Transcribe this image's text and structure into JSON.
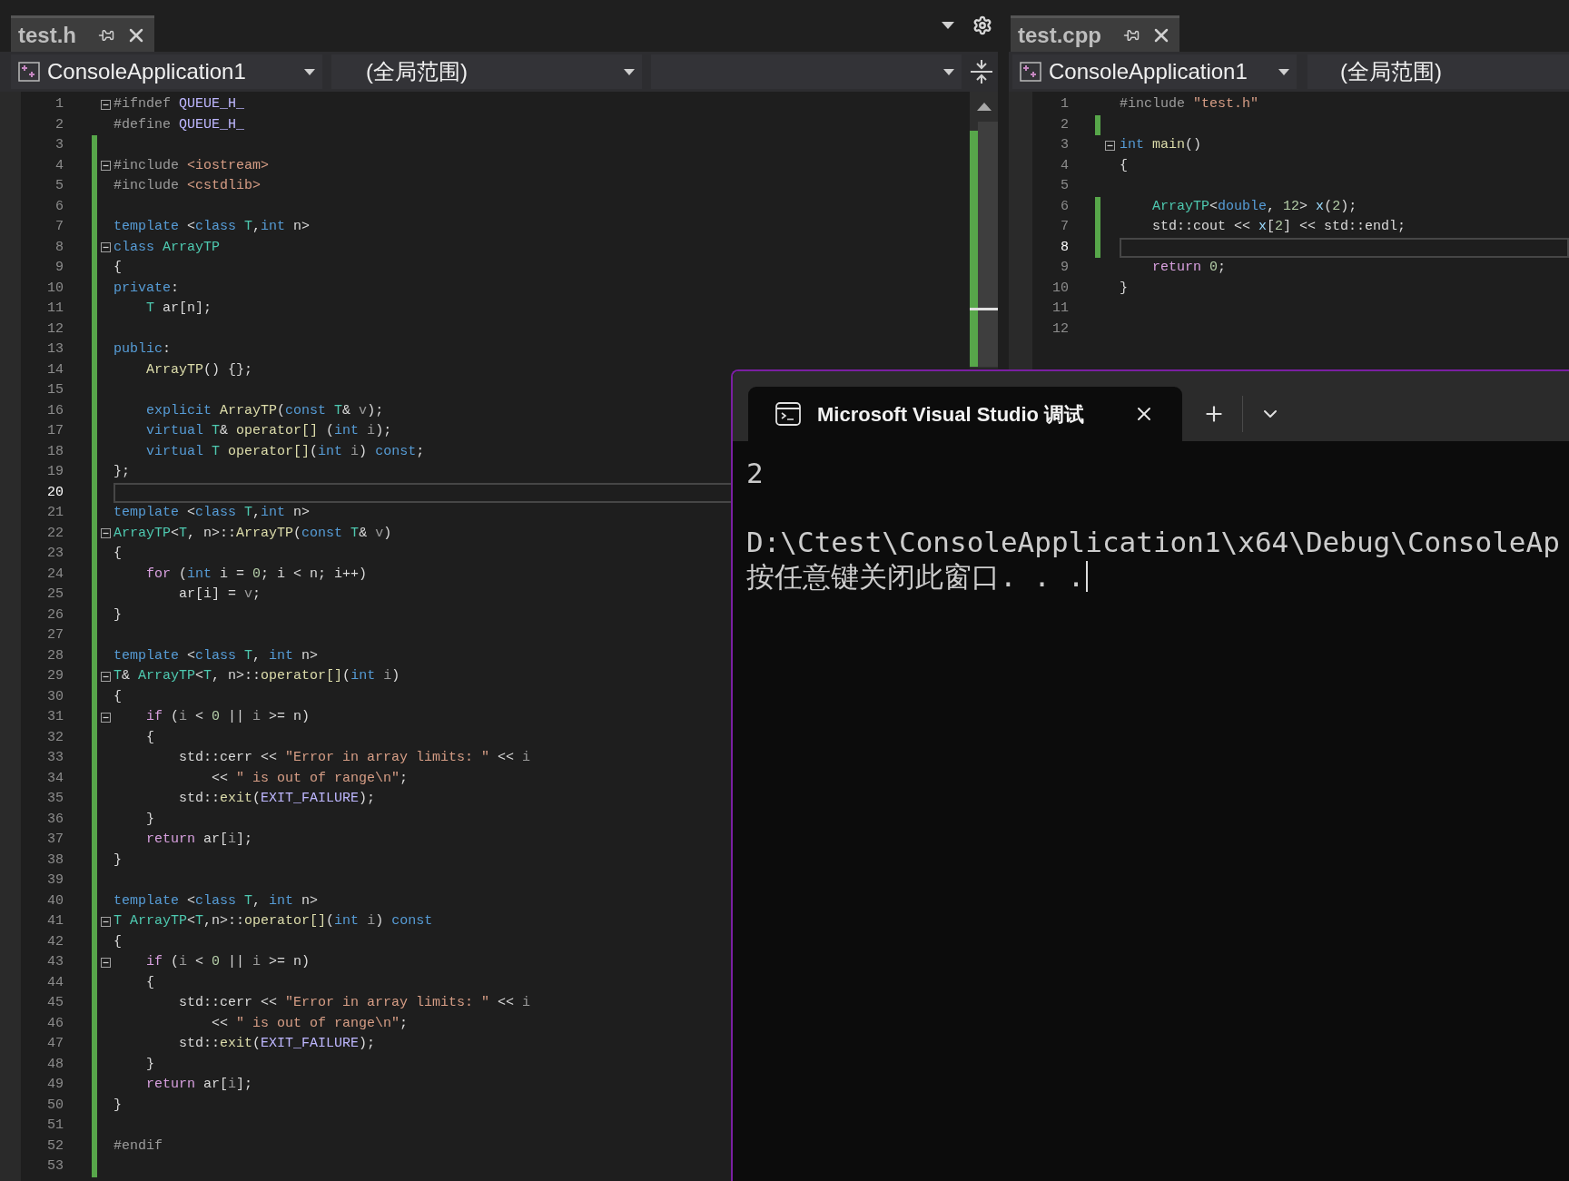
{
  "left_editor": {
    "tab": {
      "title": "test.h"
    },
    "project": "ConsoleApplication1",
    "scope": "(全局范围)",
    "lines": [
      {
        "num": "1",
        "foldable": true,
        "changed": false,
        "current": false,
        "segs": [
          {
            "kind": "pp",
            "t": "#ifndef "
          },
          {
            "kind": "macro",
            "t": "QUEUE_H_"
          }
        ]
      },
      {
        "num": "2",
        "foldable": false,
        "changed": false,
        "current": false,
        "segs": [
          {
            "kind": "pp",
            "t": "#define "
          },
          {
            "kind": "macro",
            "t": "QUEUE_H_"
          }
        ]
      },
      {
        "num": "3",
        "foldable": false,
        "changed": true,
        "current": false
      },
      {
        "num": "4",
        "foldable": true,
        "changed": true,
        "current": false,
        "segs": [
          {
            "kind": "pp",
            "t": "#include "
          },
          {
            "kind": "str",
            "t": "<iostream>"
          }
        ]
      },
      {
        "num": "5",
        "foldable": false,
        "changed": true,
        "current": false,
        "segs": [
          {
            "kind": "pp",
            "t": "#include "
          },
          {
            "kind": "str",
            "t": "<cstdlib>"
          }
        ]
      },
      {
        "num": "6",
        "foldable": false,
        "changed": true,
        "current": false
      },
      {
        "num": "7",
        "foldable": false,
        "changed": true,
        "current": false,
        "segs": [
          {
            "kind": "kw",
            "t": "template "
          },
          {
            "kind": "pl",
            "t": "<"
          },
          {
            "kind": "kw",
            "t": "class "
          },
          {
            "kind": "type",
            "t": "T"
          },
          {
            "kind": "pl",
            "t": ","
          },
          {
            "kind": "kw",
            "t": "int "
          },
          {
            "kind": "pl",
            "t": "n>"
          }
        ]
      },
      {
        "num": "8",
        "foldable": true,
        "changed": true,
        "current": false,
        "segs": [
          {
            "kind": "kw",
            "t": "class "
          },
          {
            "kind": "type",
            "t": "ArrayTP"
          }
        ]
      },
      {
        "num": "9",
        "foldable": false,
        "changed": true,
        "current": false,
        "segs": [
          {
            "kind": "pl",
            "t": "{"
          }
        ]
      },
      {
        "num": "10",
        "foldable": false,
        "changed": true,
        "current": false,
        "segs": [
          {
            "kind": "kw",
            "t": "private"
          },
          {
            "kind": "pl",
            "t": ":"
          }
        ]
      },
      {
        "num": "11",
        "foldable": false,
        "changed": true,
        "current": false,
        "segs": [
          {
            "kind": "type",
            "t": "    T"
          },
          {
            "kind": "pl",
            "t": " ar[n];"
          }
        ]
      },
      {
        "num": "12",
        "foldable": false,
        "changed": true,
        "current": false
      },
      {
        "num": "13",
        "foldable": false,
        "changed": true,
        "current": false,
        "segs": [
          {
            "kind": "kw",
            "t": "public"
          },
          {
            "kind": "pl",
            "t": ":"
          }
        ]
      },
      {
        "num": "14",
        "foldable": false,
        "changed": true,
        "current": false,
        "segs": [
          {
            "kind": "fn",
            "t": "    ArrayTP"
          },
          {
            "kind": "pl",
            "t": "() {};"
          }
        ]
      },
      {
        "num": "15",
        "foldable": false,
        "changed": true,
        "current": false
      },
      {
        "num": "16",
        "foldable": false,
        "changed": true,
        "current": false,
        "segs": [
          {
            "kind": "kw",
            "t": "    explicit "
          },
          {
            "kind": "fn",
            "t": "ArrayTP"
          },
          {
            "kind": "pl",
            "t": "("
          },
          {
            "kind": "kw",
            "t": "const "
          },
          {
            "kind": "type",
            "t": "T"
          },
          {
            "kind": "pl",
            "t": "& "
          },
          {
            "kind": "param",
            "t": "v"
          },
          {
            "kind": "pl",
            "t": ");"
          }
        ]
      },
      {
        "num": "17",
        "foldable": false,
        "changed": true,
        "current": false,
        "segs": [
          {
            "kind": "kw",
            "t": "    virtual "
          },
          {
            "kind": "type",
            "t": "T"
          },
          {
            "kind": "pl",
            "t": "& "
          },
          {
            "kind": "fn",
            "t": "operator[]"
          },
          {
            "kind": "pl",
            "t": " ("
          },
          {
            "kind": "kw",
            "t": "int "
          },
          {
            "kind": "param",
            "t": "i"
          },
          {
            "kind": "pl",
            "t": ");"
          }
        ]
      },
      {
        "num": "18",
        "foldable": false,
        "changed": true,
        "current": false,
        "segs": [
          {
            "kind": "kw",
            "t": "    virtual "
          },
          {
            "kind": "type",
            "t": "T "
          },
          {
            "kind": "fn",
            "t": "operator[]"
          },
          {
            "kind": "pl",
            "t": "("
          },
          {
            "kind": "kw",
            "t": "int "
          },
          {
            "kind": "param",
            "t": "i"
          },
          {
            "kind": "pl",
            "t": ") "
          },
          {
            "kind": "kw",
            "t": "const"
          },
          {
            "kind": "pl",
            "t": ";"
          }
        ]
      },
      {
        "num": "19",
        "foldable": false,
        "changed": true,
        "current": false,
        "segs": [
          {
            "kind": "pl",
            "t": "};"
          }
        ]
      },
      {
        "num": "20",
        "foldable": false,
        "changed": true,
        "current": true
      },
      {
        "num": "21",
        "foldable": false,
        "changed": true,
        "current": false,
        "segs": [
          {
            "kind": "kw",
            "t": "template "
          },
          {
            "kind": "pl",
            "t": "<"
          },
          {
            "kind": "kw",
            "t": "class "
          },
          {
            "kind": "type",
            "t": "T"
          },
          {
            "kind": "pl",
            "t": ","
          },
          {
            "kind": "kw",
            "t": "int "
          },
          {
            "kind": "pl",
            "t": "n>"
          }
        ]
      },
      {
        "num": "22",
        "foldable": true,
        "changed": true,
        "current": false,
        "segs": [
          {
            "kind": "type",
            "t": "ArrayTP"
          },
          {
            "kind": "pl",
            "t": "<"
          },
          {
            "kind": "type",
            "t": "T"
          },
          {
            "kind": "pl",
            "t": ", n>::"
          },
          {
            "kind": "fn",
            "t": "ArrayTP"
          },
          {
            "kind": "pl",
            "t": "("
          },
          {
            "kind": "kw",
            "t": "const "
          },
          {
            "kind": "type",
            "t": "T"
          },
          {
            "kind": "pl",
            "t": "& "
          },
          {
            "kind": "param",
            "t": "v"
          },
          {
            "kind": "pl",
            "t": ")"
          }
        ]
      },
      {
        "num": "23",
        "foldable": false,
        "changed": true,
        "current": false,
        "segs": [
          {
            "kind": "pl",
            "t": "{"
          }
        ]
      },
      {
        "num": "24",
        "foldable": false,
        "changed": true,
        "current": false,
        "segs": [
          {
            "kind": "ctl",
            "t": "    for "
          },
          {
            "kind": "pl",
            "t": "("
          },
          {
            "kind": "kw",
            "t": "int "
          },
          {
            "kind": "pl",
            "t": "i = "
          },
          {
            "kind": "num",
            "t": "0"
          },
          {
            "kind": "pl",
            "t": "; i < n; i++)"
          }
        ]
      },
      {
        "num": "25",
        "foldable": false,
        "changed": true,
        "current": false,
        "segs": [
          {
            "kind": "pl",
            "t": "        ar[i] = "
          },
          {
            "kind": "param",
            "t": "v"
          },
          {
            "kind": "pl",
            "t": ";"
          }
        ]
      },
      {
        "num": "26",
        "foldable": false,
        "changed": true,
        "current": false,
        "segs": [
          {
            "kind": "pl",
            "t": "}"
          }
        ]
      },
      {
        "num": "27",
        "foldable": false,
        "changed": true,
        "current": false
      },
      {
        "num": "28",
        "foldable": false,
        "changed": true,
        "current": false,
        "segs": [
          {
            "kind": "kw",
            "t": "template "
          },
          {
            "kind": "pl",
            "t": "<"
          },
          {
            "kind": "kw",
            "t": "class "
          },
          {
            "kind": "type",
            "t": "T"
          },
          {
            "kind": "pl",
            "t": ", "
          },
          {
            "kind": "kw",
            "t": "int "
          },
          {
            "kind": "pl",
            "t": "n>"
          }
        ]
      },
      {
        "num": "29",
        "foldable": true,
        "changed": true,
        "current": false,
        "segs": [
          {
            "kind": "type",
            "t": "T"
          },
          {
            "kind": "pl",
            "t": "& "
          },
          {
            "kind": "type",
            "t": "ArrayTP"
          },
          {
            "kind": "pl",
            "t": "<"
          },
          {
            "kind": "type",
            "t": "T"
          },
          {
            "kind": "pl",
            "t": ", n>::"
          },
          {
            "kind": "fn",
            "t": "operator[]"
          },
          {
            "kind": "pl",
            "t": "("
          },
          {
            "kind": "kw",
            "t": "int "
          },
          {
            "kind": "param",
            "t": "i"
          },
          {
            "kind": "pl",
            "t": ")"
          }
        ]
      },
      {
        "num": "30",
        "foldable": false,
        "changed": true,
        "current": false,
        "segs": [
          {
            "kind": "pl",
            "t": "{"
          }
        ]
      },
      {
        "num": "31",
        "foldable": true,
        "changed": true,
        "current": false,
        "segs": [
          {
            "kind": "ctl",
            "t": "    if "
          },
          {
            "kind": "pl",
            "t": "("
          },
          {
            "kind": "param",
            "t": "i"
          },
          {
            "kind": "pl",
            "t": " < "
          },
          {
            "kind": "num",
            "t": "0"
          },
          {
            "kind": "pl",
            "t": " || "
          },
          {
            "kind": "param",
            "t": "i"
          },
          {
            "kind": "pl",
            "t": " >= n)"
          }
        ]
      },
      {
        "num": "32",
        "foldable": false,
        "changed": true,
        "current": false,
        "segs": [
          {
            "kind": "pl",
            "t": "    {"
          }
        ]
      },
      {
        "num": "33",
        "foldable": false,
        "changed": true,
        "current": false,
        "segs": [
          {
            "kind": "pl",
            "t": "        std::cerr << "
          },
          {
            "kind": "str",
            "t": "\"Error in array limits: \""
          },
          {
            "kind": "pl",
            "t": " << "
          },
          {
            "kind": "param",
            "t": "i"
          }
        ]
      },
      {
        "num": "34",
        "foldable": false,
        "changed": true,
        "current": false,
        "segs": [
          {
            "kind": "pl",
            "t": "            << "
          },
          {
            "kind": "str",
            "t": "\" is out of range\\n\""
          },
          {
            "kind": "pl",
            "t": ";"
          }
        ]
      },
      {
        "num": "35",
        "foldable": false,
        "changed": true,
        "current": false,
        "segs": [
          {
            "kind": "pl",
            "t": "        std::"
          },
          {
            "kind": "fn",
            "t": "exit"
          },
          {
            "kind": "pl",
            "t": "("
          },
          {
            "kind": "macro",
            "t": "EXIT_FAILURE"
          },
          {
            "kind": "pl",
            "t": ");"
          }
        ]
      },
      {
        "num": "36",
        "foldable": false,
        "changed": true,
        "current": false,
        "segs": [
          {
            "kind": "pl",
            "t": "    }"
          }
        ]
      },
      {
        "num": "37",
        "foldable": false,
        "changed": true,
        "current": false,
        "segs": [
          {
            "kind": "ctl",
            "t": "    return "
          },
          {
            "kind": "pl",
            "t": "ar["
          },
          {
            "kind": "param",
            "t": "i"
          },
          {
            "kind": "pl",
            "t": "];"
          }
        ]
      },
      {
        "num": "38",
        "foldable": false,
        "changed": true,
        "current": false,
        "segs": [
          {
            "kind": "pl",
            "t": "}"
          }
        ]
      },
      {
        "num": "39",
        "foldable": false,
        "changed": true,
        "current": false
      },
      {
        "num": "40",
        "foldable": false,
        "changed": true,
        "current": false,
        "segs": [
          {
            "kind": "kw",
            "t": "template "
          },
          {
            "kind": "pl",
            "t": "<"
          },
          {
            "kind": "kw",
            "t": "class "
          },
          {
            "kind": "type",
            "t": "T"
          },
          {
            "kind": "pl",
            "t": ", "
          },
          {
            "kind": "kw",
            "t": "int "
          },
          {
            "kind": "pl",
            "t": "n>"
          }
        ]
      },
      {
        "num": "41",
        "foldable": true,
        "changed": true,
        "current": false,
        "segs": [
          {
            "kind": "type",
            "t": "T "
          },
          {
            "kind": "type",
            "t": "ArrayTP"
          },
          {
            "kind": "pl",
            "t": "<"
          },
          {
            "kind": "type",
            "t": "T"
          },
          {
            "kind": "pl",
            "t": ",n>::"
          },
          {
            "kind": "fn",
            "t": "operator[]"
          },
          {
            "kind": "pl",
            "t": "("
          },
          {
            "kind": "kw",
            "t": "int "
          },
          {
            "kind": "param",
            "t": "i"
          },
          {
            "kind": "pl",
            "t": ") "
          },
          {
            "kind": "kw",
            "t": "const"
          }
        ]
      },
      {
        "num": "42",
        "foldable": false,
        "changed": true,
        "current": false,
        "segs": [
          {
            "kind": "pl",
            "t": "{"
          }
        ]
      },
      {
        "num": "43",
        "foldable": true,
        "changed": true,
        "current": false,
        "segs": [
          {
            "kind": "ctl",
            "t": "    if "
          },
          {
            "kind": "pl",
            "t": "("
          },
          {
            "kind": "param",
            "t": "i"
          },
          {
            "kind": "pl",
            "t": " < "
          },
          {
            "kind": "num",
            "t": "0"
          },
          {
            "kind": "pl",
            "t": " || "
          },
          {
            "kind": "param",
            "t": "i"
          },
          {
            "kind": "pl",
            "t": " >= n)"
          }
        ]
      },
      {
        "num": "44",
        "foldable": false,
        "changed": true,
        "current": false,
        "segs": [
          {
            "kind": "pl",
            "t": "    {"
          }
        ]
      },
      {
        "num": "45",
        "foldable": false,
        "changed": true,
        "current": false,
        "segs": [
          {
            "kind": "pl",
            "t": "        std::cerr << "
          },
          {
            "kind": "str",
            "t": "\"Error in array limits: \""
          },
          {
            "kind": "pl",
            "t": " << "
          },
          {
            "kind": "param",
            "t": "i"
          }
        ]
      },
      {
        "num": "46",
        "foldable": false,
        "changed": true,
        "current": false,
        "segs": [
          {
            "kind": "pl",
            "t": "            << "
          },
          {
            "kind": "str",
            "t": "\" is out of range\\n\""
          },
          {
            "kind": "pl",
            "t": ";"
          }
        ]
      },
      {
        "num": "47",
        "foldable": false,
        "changed": true,
        "current": false,
        "segs": [
          {
            "kind": "pl",
            "t": "        std::"
          },
          {
            "kind": "fn",
            "t": "exit"
          },
          {
            "kind": "pl",
            "t": "("
          },
          {
            "kind": "macro",
            "t": "EXIT_FAILURE"
          },
          {
            "kind": "pl",
            "t": ");"
          }
        ]
      },
      {
        "num": "48",
        "foldable": false,
        "changed": true,
        "current": false,
        "segs": [
          {
            "kind": "pl",
            "t": "    }"
          }
        ]
      },
      {
        "num": "49",
        "foldable": false,
        "changed": true,
        "current": false,
        "segs": [
          {
            "kind": "ctl",
            "t": "    return "
          },
          {
            "kind": "pl",
            "t": "ar["
          },
          {
            "kind": "param",
            "t": "i"
          },
          {
            "kind": "pl",
            "t": "];"
          }
        ]
      },
      {
        "num": "50",
        "foldable": false,
        "changed": true,
        "current": false,
        "segs": [
          {
            "kind": "pl",
            "t": "}"
          }
        ]
      },
      {
        "num": "51",
        "foldable": false,
        "changed": true,
        "current": false
      },
      {
        "num": "52",
        "foldable": false,
        "changed": true,
        "current": false,
        "segs": [
          {
            "kind": "pp",
            "t": "#endif"
          }
        ]
      },
      {
        "num": "53",
        "foldable": false,
        "changed": true,
        "current": false
      }
    ]
  },
  "right_editor": {
    "tab": {
      "title": "test.cpp"
    },
    "project": "ConsoleApplication1",
    "scope": "(全局范围)",
    "lines": [
      {
        "num": "1",
        "foldable": false,
        "changed": false,
        "current": false,
        "segs": [
          {
            "kind": "pp",
            "t": "#include "
          },
          {
            "kind": "str",
            "t": "\"test.h\""
          }
        ]
      },
      {
        "num": "2",
        "foldable": false,
        "changed": true,
        "current": false
      },
      {
        "num": "3",
        "foldable": true,
        "changed": false,
        "current": false,
        "segs": [
          {
            "kind": "kw",
            "t": "int "
          },
          {
            "kind": "fn",
            "t": "main"
          },
          {
            "kind": "pl",
            "t": "()"
          }
        ]
      },
      {
        "num": "4",
        "foldable": false,
        "changed": false,
        "current": false,
        "segs": [
          {
            "kind": "pl",
            "t": "{"
          }
        ]
      },
      {
        "num": "5",
        "foldable": false,
        "changed": false,
        "current": false
      },
      {
        "num": "6",
        "foldable": false,
        "changed": true,
        "current": false,
        "segs": [
          {
            "kind": "type",
            "t": "    ArrayTP"
          },
          {
            "kind": "pl",
            "t": "<"
          },
          {
            "kind": "kw",
            "t": "double"
          },
          {
            "kind": "pl",
            "t": ", "
          },
          {
            "kind": "num",
            "t": "12"
          },
          {
            "kind": "pl",
            "t": "> "
          },
          {
            "kind": "local",
            "t": "x"
          },
          {
            "kind": "pl",
            "t": "("
          },
          {
            "kind": "num",
            "t": "2"
          },
          {
            "kind": "pl",
            "t": ");"
          }
        ]
      },
      {
        "num": "7",
        "foldable": false,
        "changed": true,
        "current": false,
        "segs": [
          {
            "kind": "pl",
            "t": "    std::cout << "
          },
          {
            "kind": "local",
            "t": "x"
          },
          {
            "kind": "pl",
            "t": "["
          },
          {
            "kind": "num",
            "t": "2"
          },
          {
            "kind": "pl",
            "t": "] << std::endl;"
          }
        ]
      },
      {
        "num": "8",
        "foldable": false,
        "changed": true,
        "current": true
      },
      {
        "num": "9",
        "foldable": false,
        "changed": false,
        "current": false,
        "segs": [
          {
            "kind": "ctl",
            "t": "    return "
          },
          {
            "kind": "num",
            "t": "0"
          },
          {
            "kind": "pl",
            "t": ";"
          }
        ]
      },
      {
        "num": "10",
        "foldable": false,
        "changed": false,
        "current": false,
        "segs": [
          {
            "kind": "pl",
            "t": "}"
          }
        ]
      },
      {
        "num": "11",
        "foldable": false,
        "changed": false,
        "current": false
      },
      {
        "num": "12",
        "foldable": false,
        "changed": false,
        "current": false
      }
    ]
  },
  "console": {
    "tab_title": "Microsoft Visual Studio 调试",
    "cursor_visible": true,
    "paragraphs": [
      [
        "2"
      ],
      [
        "D:\\Ctest\\ConsoleApplication1\\x64\\Debug\\ConsoleAp",
        "按任意键关闭此窗口. . ."
      ]
    ]
  }
}
